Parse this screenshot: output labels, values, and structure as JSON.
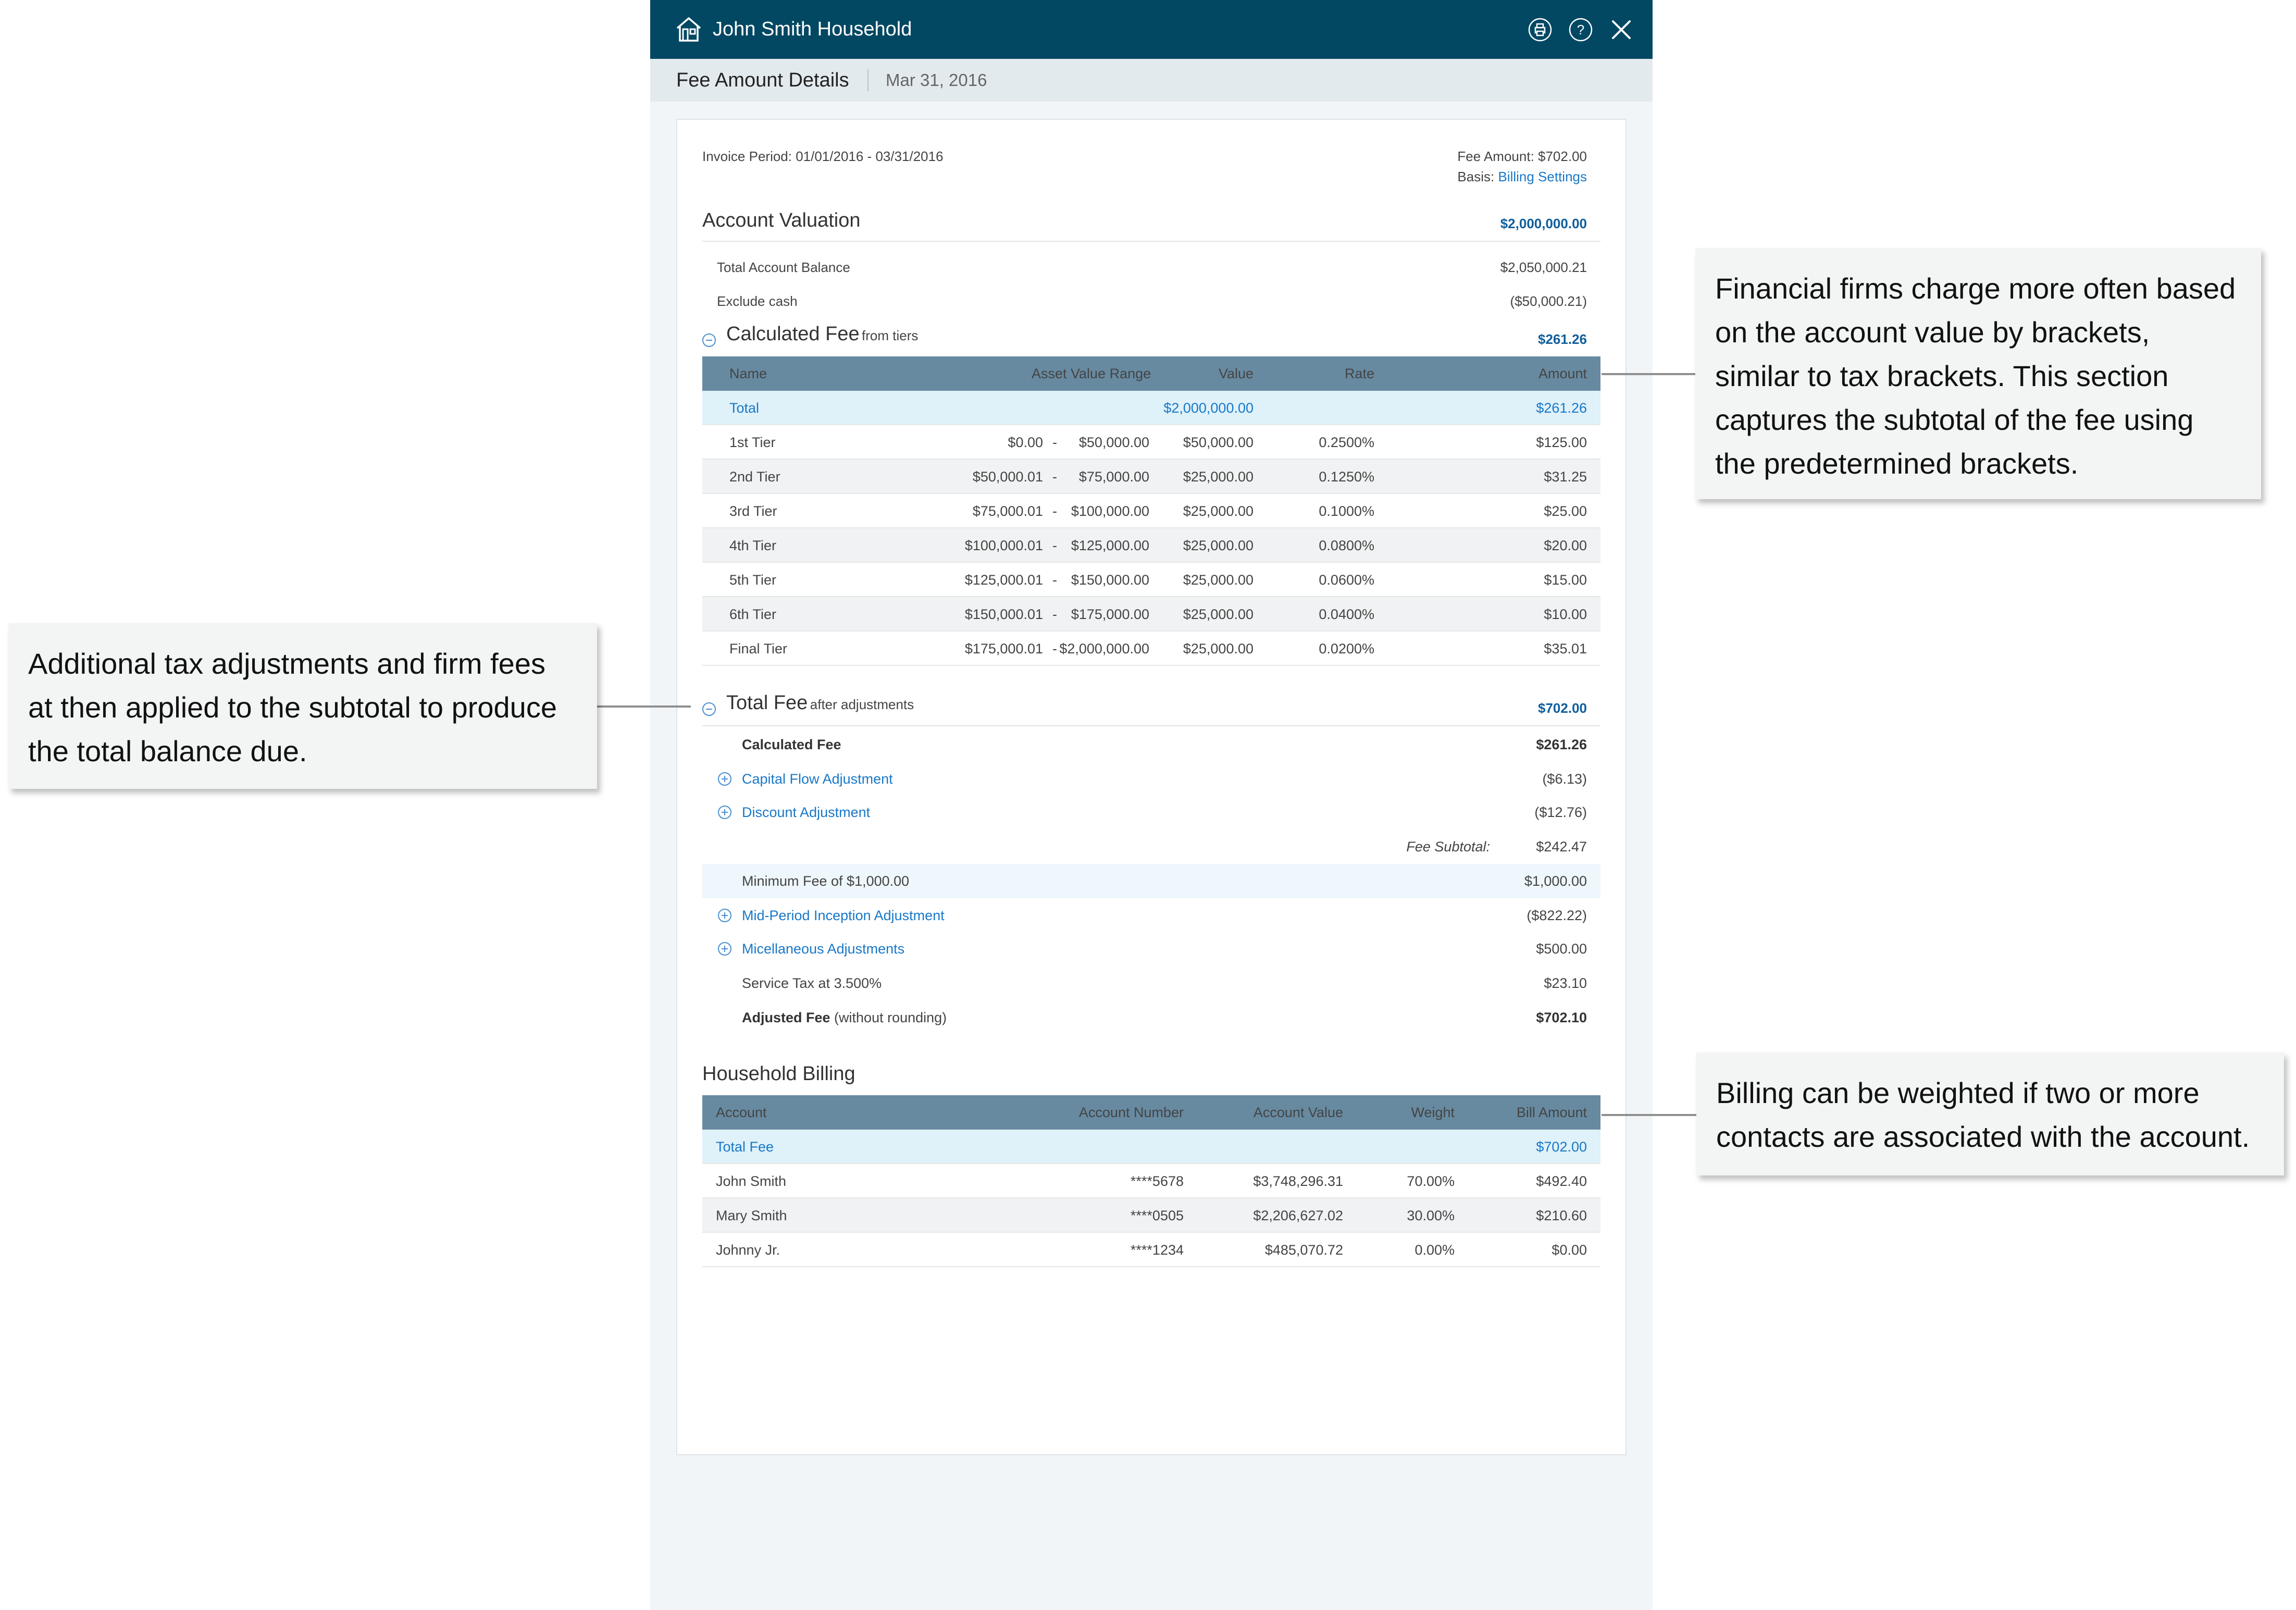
{
  "window": {
    "title": "John Smith Household",
    "subtitle": "Fee Amount Details",
    "date": "Mar 31, 2016",
    "icons": [
      "home-icon",
      "print-icon",
      "help-icon",
      "close-icon"
    ]
  },
  "summary": {
    "invoice_period": "Invoice Period: 01/01/2016 - 03/31/2016",
    "fee_amount": "Fee Amount: $702.00",
    "basis_label": "Basis:",
    "basis_link": "Billing Settings"
  },
  "account_valuation": {
    "title": "Account Valuation",
    "amount": "$2,000,000.00",
    "rows": [
      {
        "label": "Total Account Balance",
        "value": "$2,050,000.21"
      },
      {
        "label": "Exclude cash",
        "value": "($50,000.21)"
      }
    ]
  },
  "calculated_fee": {
    "title": "Calculated Fee",
    "subtitle": "from tiers",
    "amount": "$261.26",
    "columns": [
      "Name",
      "Asset Value Range",
      "Value",
      "Rate",
      "Amount"
    ],
    "total": {
      "name": "Total",
      "value": "$2,000,000.00",
      "amount": "$261.26"
    },
    "tiers": [
      {
        "name": "1st Tier",
        "from": "$0.00",
        "to": "$50,000.00",
        "value": "$50,000.00",
        "rate": "0.2500%",
        "amount": "$125.00"
      },
      {
        "name": "2nd Tier",
        "from": "$50,000.01",
        "to": "$75,000.00",
        "value": "$25,000.00",
        "rate": "0.1250%",
        "amount": "$31.25"
      },
      {
        "name": "3rd Tier",
        "from": "$75,000.01",
        "to": "$100,000.00",
        "value": "$25,000.00",
        "rate": "0.1000%",
        "amount": "$25.00"
      },
      {
        "name": "4th Tier",
        "from": "$100,000.01",
        "to": "$125,000.00",
        "value": "$25,000.00",
        "rate": "0.0800%",
        "amount": "$20.00"
      },
      {
        "name": "5th Tier",
        "from": "$125,000.01",
        "to": "$150,000.00",
        "value": "$25,000.00",
        "rate": "0.0600%",
        "amount": "$15.00"
      },
      {
        "name": "6th Tier",
        "from": "$150,000.01",
        "to": "$175,000.00",
        "value": "$25,000.00",
        "rate": "0.0400%",
        "amount": "$10.00"
      },
      {
        "name": "Final Tier",
        "from": "$175,000.01",
        "to": "$2,000,000.00",
        "value": "$25,000.00",
        "rate": "0.0200%",
        "amount": "$35.01"
      }
    ]
  },
  "total_fee": {
    "title": "Total Fee",
    "subtitle": "after adjustments",
    "amount": "$702.00",
    "calculated_fee": {
      "label": "Calculated Fee",
      "value": "$261.26"
    },
    "capital_flow": {
      "label": "Capital Flow Adjustment",
      "value": "($6.13)"
    },
    "discount": {
      "label": "Discount Adjustment",
      "value": "($12.76)"
    },
    "fee_subtotal": {
      "label": "Fee Subtotal:",
      "value": "$242.47"
    },
    "minimum_fee": {
      "label": "Minimum Fee of $1,000.00",
      "value": "$1,000.00"
    },
    "mid_period": {
      "label": "Mid-Period Inception Adjustment",
      "value": "($822.22)"
    },
    "misc": {
      "label": "Micellaneous Adjustments",
      "value": "$500.00"
    },
    "service_tax": {
      "label": "Service Tax at 3.500%",
      "value": "$23.10"
    },
    "adjusted_fee": {
      "label": "Adjusted Fee",
      "note": "(without rounding)",
      "value": "$702.10"
    }
  },
  "household_billing": {
    "title": "Household Billing",
    "columns": [
      "Account",
      "Account Number",
      "Account Value",
      "Weight",
      "Bill Amount"
    ],
    "total": {
      "label": "Total Fee",
      "amount": "$702.00"
    },
    "rows": [
      {
        "account": "John Smith",
        "number": "****5678",
        "value": "$3,748,296.31",
        "weight": "70.00%",
        "amount": "$492.40"
      },
      {
        "account": "Mary Smith",
        "number": "****0505",
        "value": "$2,206,627.02",
        "weight": "30.00%",
        "amount": "$210.60"
      },
      {
        "account": "Johnny Jr.",
        "number": "****1234",
        "value": "$485,070.72",
        "weight": "0.00%",
        "amount": "$0.00"
      }
    ]
  },
  "callouts": {
    "brackets": "Financial firms charge more often based on the account value by brackets, similar to tax brackets. This section captures the subtotal of the fee using the predetermined brackets.",
    "adjustments": "Additional tax adjustments and firm fees at then applied to the subtotal to produce the total balance due.",
    "weighting": "Billing can be weighted if two or more contacts are associated with the account."
  }
}
